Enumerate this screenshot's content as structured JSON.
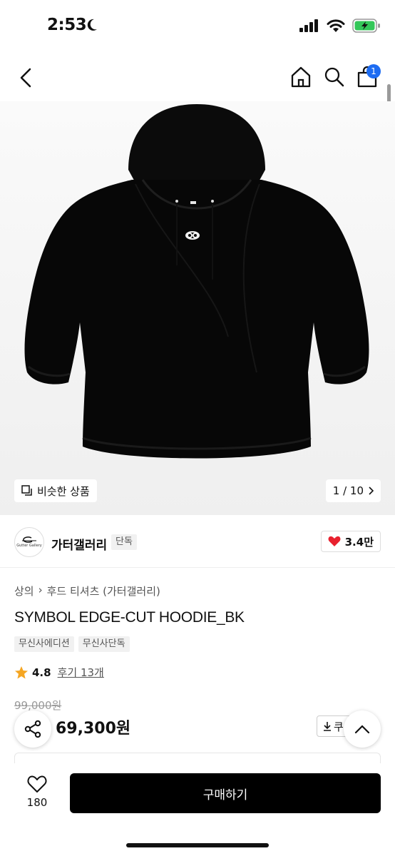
{
  "status_bar": {
    "time": "2:53"
  },
  "nav": {
    "cart_count": "1"
  },
  "gallery": {
    "similar_label": "비슷한 상품",
    "counter": "1 / 10"
  },
  "brand": {
    "name": "가터갤러리",
    "tag": "단독",
    "logo_text": "Gutter Gallery",
    "likes": "3.4만"
  },
  "product": {
    "breadcrumb": [
      "상의",
      "후드 티셔츠 (가터갤러리)"
    ],
    "title": "SYMBOL EDGE-CUT HOODIE_BK",
    "tags": [
      "무신사에디션",
      "무신사단독"
    ],
    "rating": "4.8",
    "review_link": "후기 13개",
    "original_price": "99,000원",
    "price": "69,300원",
    "coupon_label": "쿠"
  },
  "bottom": {
    "wish_count": "180",
    "buy_label": "구매하기"
  },
  "colors": {
    "accent": "#1d6cf2",
    "heart": "#e8212e",
    "star": "#f5a623",
    "battery": "#34c759"
  }
}
